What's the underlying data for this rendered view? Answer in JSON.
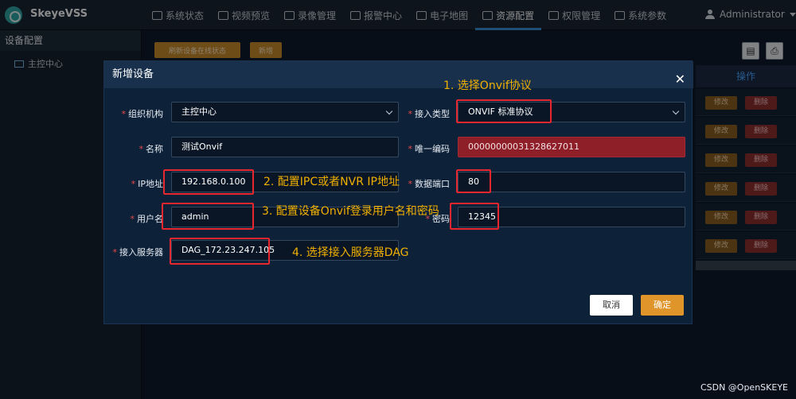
{
  "app": {
    "brand": "SkeyeVSS"
  },
  "nav": [
    {
      "label": "系统状态",
      "icon": "chart-icon"
    },
    {
      "label": "视频预览",
      "icon": "camera-icon"
    },
    {
      "label": "录像管理",
      "icon": "video-icon"
    },
    {
      "label": "报警中心",
      "icon": "alarm-icon"
    },
    {
      "label": "电子地图",
      "icon": "map-icon"
    },
    {
      "label": "资源配置",
      "icon": "grid-icon",
      "active": true
    },
    {
      "label": "权限管理",
      "icon": "lock-icon"
    },
    {
      "label": "系统参数",
      "icon": "gear-icon"
    }
  ],
  "user": {
    "name": "Administrator"
  },
  "sidebar": {
    "title": "设备配置",
    "item": "主控中心"
  },
  "toolbar": {
    "refresh_label": "刷新设备在线状态",
    "add_label": "新增"
  },
  "table": {
    "action_header": "操作",
    "rows": [
      {
        "edit": "修改",
        "delete": "删除"
      },
      {
        "edit": "修改",
        "delete": "删除"
      },
      {
        "edit": "修改",
        "delete": "删除"
      },
      {
        "edit": "修改",
        "delete": "删除"
      },
      {
        "edit": "修改",
        "delete": "删除"
      },
      {
        "edit": "修改",
        "delete": "删除"
      }
    ]
  },
  "modal": {
    "title": "新增设备",
    "labels": {
      "org": "组织机构",
      "access_type": "接入类型",
      "name": "名称",
      "unique_code": "唯一编码",
      "ip": "IP地址",
      "data_port": "数据端口",
      "username": "用户名",
      "password": "密码",
      "server": "接入服务器"
    },
    "values": {
      "org": "主控中心",
      "access_type": "ONVIF 标准协议",
      "name": "测试Onvif",
      "unique_code": "00000000031328627011",
      "ip": "192.168.0.100",
      "data_port": "80",
      "username": "admin",
      "password": "12345",
      "server": "DAG_172.23.247.105"
    },
    "cancel_label": "取消",
    "ok_label": "确定"
  },
  "annotations": {
    "a1": "1. 选择Onvif协议",
    "a2": "2. 配置IPC或者NVR IP地址",
    "a3": "3. 配置设备Onvif登录用户名和密码",
    "a4": "4. 选择接入服务器DAG"
  },
  "watermark": "CSDN @OpenSKEYE",
  "colors": {
    "accent": "#3a8fd6",
    "highlight": "#e8262d",
    "annotation": "#f0b000",
    "ok": "#e0952a"
  }
}
